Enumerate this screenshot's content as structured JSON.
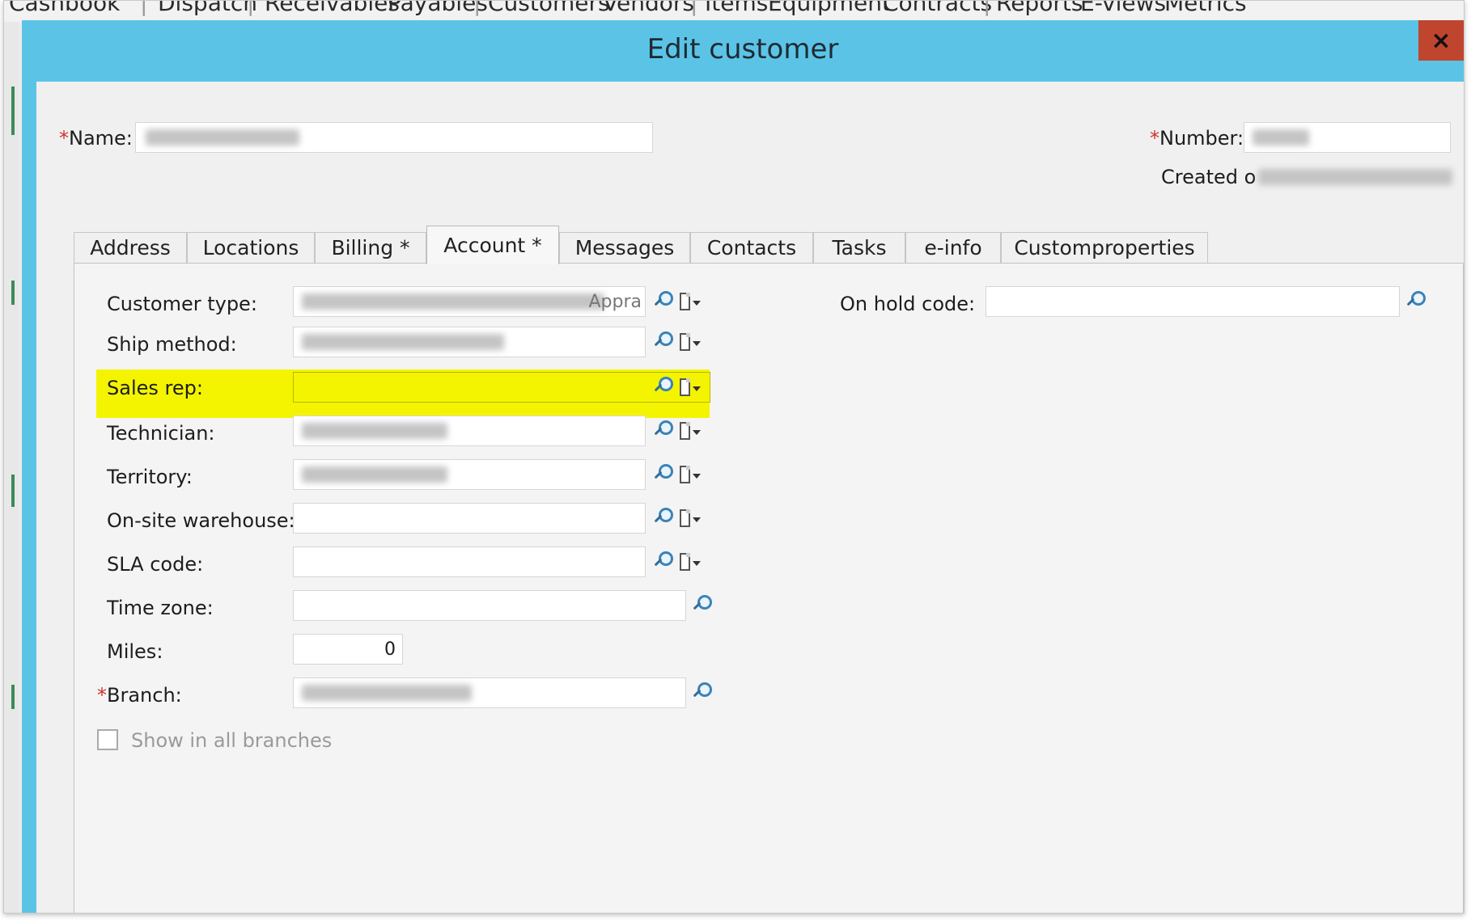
{
  "topnav": [
    "Cashbook",
    "Dispatch",
    "Receivables",
    "Payables",
    "Customers",
    "Vendors",
    "Items",
    "Equipment",
    "Contracts",
    "Reports",
    "E-views",
    "Metrics"
  ],
  "dialog": {
    "title": "Edit customer",
    "close_label": "×"
  },
  "header": {
    "name_label": "Name:",
    "number_label": "Number:",
    "created_label": "Created o"
  },
  "tabs": [
    "Address",
    "Locations",
    "Billing *",
    "Account *",
    "Messages",
    "Contacts",
    "Tasks",
    "e-info",
    "Customproperties"
  ],
  "active_tab": "Account *",
  "form": {
    "customer_type": {
      "label": "Customer type:",
      "visible_text": "Appra"
    },
    "ship_method": {
      "label": "Ship method:"
    },
    "sales_rep": {
      "label": "Sales rep:",
      "value": ""
    },
    "technician": {
      "label": "Technician:"
    },
    "territory": {
      "label": "Territory:"
    },
    "onsite_warehouse": {
      "label": "On-site warehouse:",
      "value": ""
    },
    "sla_code": {
      "label": "SLA code:",
      "value": ""
    },
    "time_zone": {
      "label": "Time zone:",
      "value": ""
    },
    "miles": {
      "label": "Miles:",
      "value": "0"
    },
    "branch": {
      "label": "Branch:"
    },
    "show_all_branches": {
      "label": "Show in all branches",
      "checked": false
    },
    "on_hold_code": {
      "label": "On hold code:",
      "value": ""
    }
  },
  "required_marker": "*",
  "colors": {
    "title_bar": "#5bc4e6",
    "highlight": "#f4f400",
    "close_button": "#c0452f",
    "required": "#d2332b"
  },
  "icons": [
    "lookup-icon",
    "document-dropdown-icon",
    "close-icon"
  ]
}
